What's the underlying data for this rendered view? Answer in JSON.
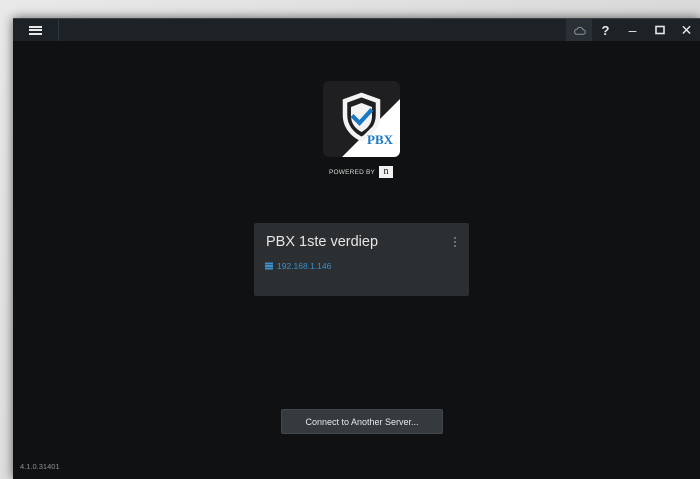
{
  "window": {
    "version": "4.1.0.31401"
  },
  "titlebar": {
    "menu_icon": "hamburger-icon",
    "cloud_icon": "cloud-icon",
    "help_label": "?",
    "minimize_label": "–",
    "maximize_icon": "maximize-icon",
    "close_label": "✕"
  },
  "logo": {
    "badge_text": "PBX",
    "powered_by": "POWERED BY",
    "powered_mark": "n"
  },
  "server_card": {
    "name": "PBX 1ste verdiep",
    "ip": "192.168.1.146",
    "accent_color": "#3a8fcf"
  },
  "connect_button": {
    "label": "Connect to Another Server..."
  }
}
